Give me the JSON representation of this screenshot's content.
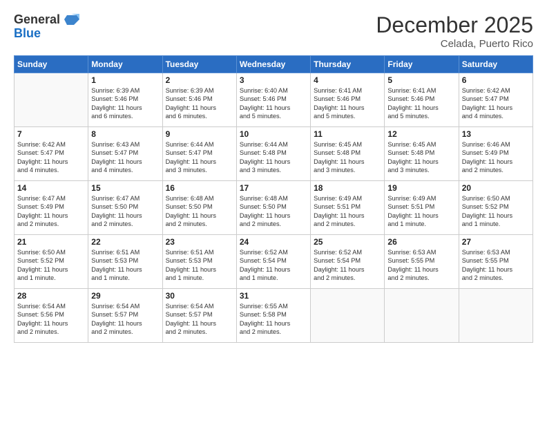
{
  "header": {
    "logo_line1": "General",
    "logo_line2": "Blue",
    "month": "December 2025",
    "location": "Celada, Puerto Rico"
  },
  "days_of_week": [
    "Sunday",
    "Monday",
    "Tuesday",
    "Wednesday",
    "Thursday",
    "Friday",
    "Saturday"
  ],
  "weeks": [
    [
      {
        "day": "",
        "info": ""
      },
      {
        "day": "1",
        "info": "Sunrise: 6:39 AM\nSunset: 5:46 PM\nDaylight: 11 hours\nand 6 minutes."
      },
      {
        "day": "2",
        "info": "Sunrise: 6:39 AM\nSunset: 5:46 PM\nDaylight: 11 hours\nand 6 minutes."
      },
      {
        "day": "3",
        "info": "Sunrise: 6:40 AM\nSunset: 5:46 PM\nDaylight: 11 hours\nand 5 minutes."
      },
      {
        "day": "4",
        "info": "Sunrise: 6:41 AM\nSunset: 5:46 PM\nDaylight: 11 hours\nand 5 minutes."
      },
      {
        "day": "5",
        "info": "Sunrise: 6:41 AM\nSunset: 5:46 PM\nDaylight: 11 hours\nand 5 minutes."
      },
      {
        "day": "6",
        "info": "Sunrise: 6:42 AM\nSunset: 5:47 PM\nDaylight: 11 hours\nand 4 minutes."
      }
    ],
    [
      {
        "day": "7",
        "info": "Sunrise: 6:42 AM\nSunset: 5:47 PM\nDaylight: 11 hours\nand 4 minutes."
      },
      {
        "day": "8",
        "info": "Sunrise: 6:43 AM\nSunset: 5:47 PM\nDaylight: 11 hours\nand 4 minutes."
      },
      {
        "day": "9",
        "info": "Sunrise: 6:44 AM\nSunset: 5:47 PM\nDaylight: 11 hours\nand 3 minutes."
      },
      {
        "day": "10",
        "info": "Sunrise: 6:44 AM\nSunset: 5:48 PM\nDaylight: 11 hours\nand 3 minutes."
      },
      {
        "day": "11",
        "info": "Sunrise: 6:45 AM\nSunset: 5:48 PM\nDaylight: 11 hours\nand 3 minutes."
      },
      {
        "day": "12",
        "info": "Sunrise: 6:45 AM\nSunset: 5:48 PM\nDaylight: 11 hours\nand 3 minutes."
      },
      {
        "day": "13",
        "info": "Sunrise: 6:46 AM\nSunset: 5:49 PM\nDaylight: 11 hours\nand 2 minutes."
      }
    ],
    [
      {
        "day": "14",
        "info": "Sunrise: 6:47 AM\nSunset: 5:49 PM\nDaylight: 11 hours\nand 2 minutes."
      },
      {
        "day": "15",
        "info": "Sunrise: 6:47 AM\nSunset: 5:50 PM\nDaylight: 11 hours\nand 2 minutes."
      },
      {
        "day": "16",
        "info": "Sunrise: 6:48 AM\nSunset: 5:50 PM\nDaylight: 11 hours\nand 2 minutes."
      },
      {
        "day": "17",
        "info": "Sunrise: 6:48 AM\nSunset: 5:50 PM\nDaylight: 11 hours\nand 2 minutes."
      },
      {
        "day": "18",
        "info": "Sunrise: 6:49 AM\nSunset: 5:51 PM\nDaylight: 11 hours\nand 2 minutes."
      },
      {
        "day": "19",
        "info": "Sunrise: 6:49 AM\nSunset: 5:51 PM\nDaylight: 11 hours\nand 1 minute."
      },
      {
        "day": "20",
        "info": "Sunrise: 6:50 AM\nSunset: 5:52 PM\nDaylight: 11 hours\nand 1 minute."
      }
    ],
    [
      {
        "day": "21",
        "info": "Sunrise: 6:50 AM\nSunset: 5:52 PM\nDaylight: 11 hours\nand 1 minute."
      },
      {
        "day": "22",
        "info": "Sunrise: 6:51 AM\nSunset: 5:53 PM\nDaylight: 11 hours\nand 1 minute."
      },
      {
        "day": "23",
        "info": "Sunrise: 6:51 AM\nSunset: 5:53 PM\nDaylight: 11 hours\nand 1 minute."
      },
      {
        "day": "24",
        "info": "Sunrise: 6:52 AM\nSunset: 5:54 PM\nDaylight: 11 hours\nand 1 minute."
      },
      {
        "day": "25",
        "info": "Sunrise: 6:52 AM\nSunset: 5:54 PM\nDaylight: 11 hours\nand 2 minutes."
      },
      {
        "day": "26",
        "info": "Sunrise: 6:53 AM\nSunset: 5:55 PM\nDaylight: 11 hours\nand 2 minutes."
      },
      {
        "day": "27",
        "info": "Sunrise: 6:53 AM\nSunset: 5:55 PM\nDaylight: 11 hours\nand 2 minutes."
      }
    ],
    [
      {
        "day": "28",
        "info": "Sunrise: 6:54 AM\nSunset: 5:56 PM\nDaylight: 11 hours\nand 2 minutes."
      },
      {
        "day": "29",
        "info": "Sunrise: 6:54 AM\nSunset: 5:57 PM\nDaylight: 11 hours\nand 2 minutes."
      },
      {
        "day": "30",
        "info": "Sunrise: 6:54 AM\nSunset: 5:57 PM\nDaylight: 11 hours\nand 2 minutes."
      },
      {
        "day": "31",
        "info": "Sunrise: 6:55 AM\nSunset: 5:58 PM\nDaylight: 11 hours\nand 2 minutes."
      },
      {
        "day": "",
        "info": ""
      },
      {
        "day": "",
        "info": ""
      },
      {
        "day": "",
        "info": ""
      }
    ]
  ]
}
